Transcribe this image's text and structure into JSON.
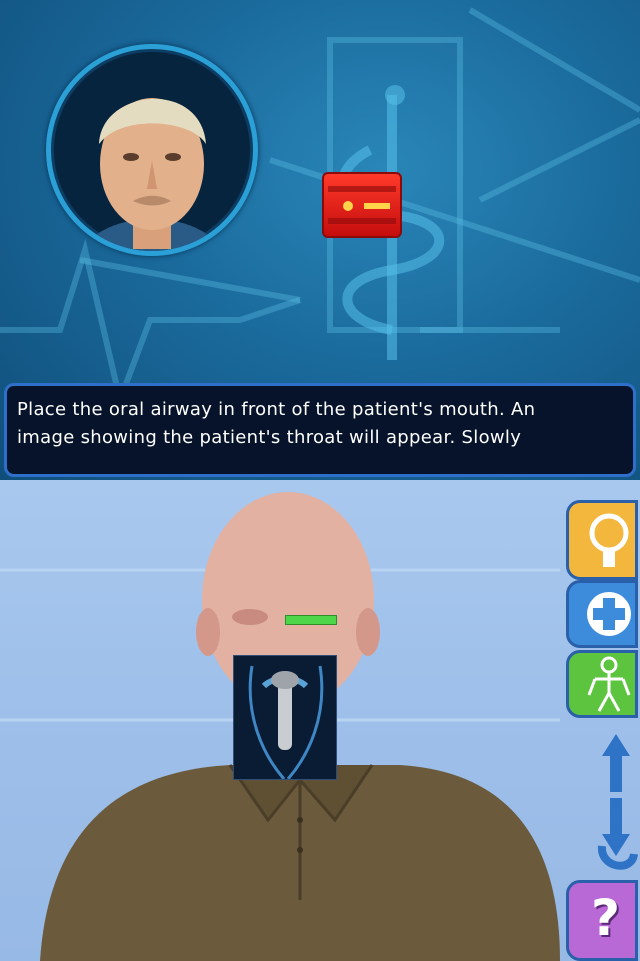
{
  "dialog": {
    "line1": "Place the oral airway in front of the patient's mouth. An",
    "line2": "image showing the patient's throat will appear. Slowly"
  },
  "toolbar": {
    "items": [
      {
        "icon": "magnify-icon",
        "color": "#f3b73e"
      },
      {
        "icon": "medical-cross-icon",
        "color": "#3d8cdc"
      },
      {
        "icon": "body-icon",
        "color": "#5cc43e"
      },
      {
        "icon": "rotate-arrows-icon",
        "color": "#2f73c7"
      },
      {
        "icon": "help-icon",
        "color": "#b969d6",
        "label": "?"
      }
    ]
  },
  "colors": {
    "top_background": "#1a6a9c",
    "bottom_background": "#a9c8ee",
    "dialog_background": "#06132a",
    "dialog_border": "#2e6fc9",
    "oxygen_tank": "#d61a14",
    "eye_indicator": "#4ed64a"
  }
}
